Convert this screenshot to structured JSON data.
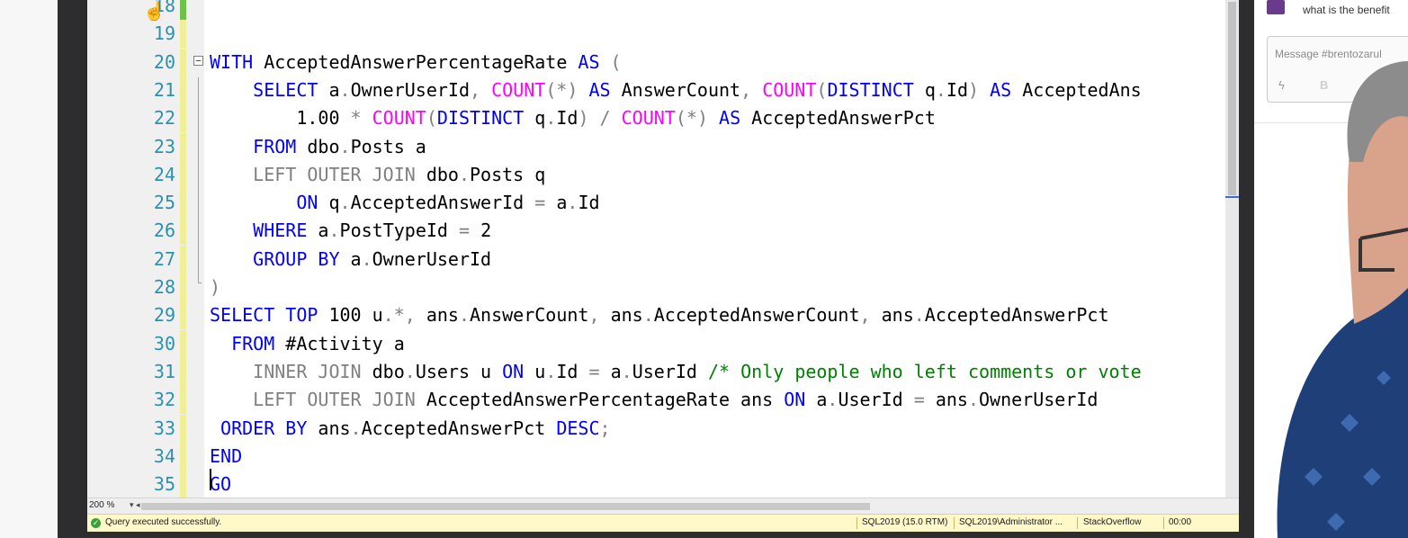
{
  "editor": {
    "lines": [
      {
        "num": "18",
        "change": "saved",
        "tokens": []
      },
      {
        "num": "19",
        "change": "unsaved",
        "tokens": []
      },
      {
        "num": "20",
        "change": "unsaved",
        "tokens": [
          {
            "t": "WITH",
            "c": "kw"
          },
          {
            "t": " AcceptedAnswerPercentageRate ",
            "c": "tx"
          },
          {
            "t": "AS",
            "c": "kw"
          },
          {
            "t": " (",
            "c": "gr"
          }
        ]
      },
      {
        "num": "21",
        "change": "unsaved",
        "tokens": [
          {
            "t": "    ",
            "c": "tx"
          },
          {
            "t": "SELECT",
            "c": "kw"
          },
          {
            "t": " a",
            "c": "tx"
          },
          {
            "t": ".",
            "c": "gr"
          },
          {
            "t": "OwnerUserId",
            "c": "tx"
          },
          {
            "t": ", ",
            "c": "gr"
          },
          {
            "t": "COUNT",
            "c": "fn"
          },
          {
            "t": "(*)",
            "c": "gr"
          },
          {
            "t": " ",
            "c": "tx"
          },
          {
            "t": "AS",
            "c": "kw"
          },
          {
            "t": " AnswerCount",
            "c": "tx"
          },
          {
            "t": ", ",
            "c": "gr"
          },
          {
            "t": "COUNT",
            "c": "fn"
          },
          {
            "t": "(",
            "c": "gr"
          },
          {
            "t": "DISTINCT",
            "c": "kw"
          },
          {
            "t": " q",
            "c": "tx"
          },
          {
            "t": ".",
            "c": "gr"
          },
          {
            "t": "Id",
            "c": "tx"
          },
          {
            "t": ")",
            "c": "gr"
          },
          {
            "t": " ",
            "c": "tx"
          },
          {
            "t": "AS",
            "c": "kw"
          },
          {
            "t": " AcceptedAns",
            "c": "tx"
          }
        ]
      },
      {
        "num": "22",
        "change": "unsaved",
        "tokens": [
          {
            "t": "        1.00 ",
            "c": "tx"
          },
          {
            "t": "*",
            "c": "gr"
          },
          {
            "t": " ",
            "c": "tx"
          },
          {
            "t": "COUNT",
            "c": "fn"
          },
          {
            "t": "(",
            "c": "gr"
          },
          {
            "t": "DISTINCT",
            "c": "kw"
          },
          {
            "t": " q",
            "c": "tx"
          },
          {
            "t": ".",
            "c": "gr"
          },
          {
            "t": "Id",
            "c": "tx"
          },
          {
            "t": ") / ",
            "c": "gr"
          },
          {
            "t": "COUNT",
            "c": "fn"
          },
          {
            "t": "(*)",
            "c": "gr"
          },
          {
            "t": " ",
            "c": "tx"
          },
          {
            "t": "AS",
            "c": "kw"
          },
          {
            "t": " AcceptedAnswerPct",
            "c": "tx"
          }
        ]
      },
      {
        "num": "23",
        "change": "unsaved",
        "tokens": [
          {
            "t": "    ",
            "c": "tx"
          },
          {
            "t": "FROM",
            "c": "kw"
          },
          {
            "t": " dbo",
            "c": "tx"
          },
          {
            "t": ".",
            "c": "gr"
          },
          {
            "t": "Posts a",
            "c": "tx"
          }
        ]
      },
      {
        "num": "24",
        "change": "unsaved",
        "tokens": [
          {
            "t": "    ",
            "c": "tx"
          },
          {
            "t": "LEFT OUTER JOIN",
            "c": "gr"
          },
          {
            "t": " dbo",
            "c": "tx"
          },
          {
            "t": ".",
            "c": "gr"
          },
          {
            "t": "Posts q",
            "c": "tx"
          }
        ]
      },
      {
        "num": "25",
        "change": "unsaved",
        "tokens": [
          {
            "t": "        ",
            "c": "tx"
          },
          {
            "t": "ON",
            "c": "kw"
          },
          {
            "t": " q",
            "c": "tx"
          },
          {
            "t": ".",
            "c": "gr"
          },
          {
            "t": "AcceptedAnswerId ",
            "c": "tx"
          },
          {
            "t": "=",
            "c": "gr"
          },
          {
            "t": " a",
            "c": "tx"
          },
          {
            "t": ".",
            "c": "gr"
          },
          {
            "t": "Id",
            "c": "tx"
          }
        ]
      },
      {
        "num": "26",
        "change": "unsaved",
        "tokens": [
          {
            "t": "    ",
            "c": "tx"
          },
          {
            "t": "WHERE",
            "c": "kw"
          },
          {
            "t": " a",
            "c": "tx"
          },
          {
            "t": ".",
            "c": "gr"
          },
          {
            "t": "PostTypeId ",
            "c": "tx"
          },
          {
            "t": "=",
            "c": "gr"
          },
          {
            "t": " 2",
            "c": "tx"
          }
        ]
      },
      {
        "num": "27",
        "change": "unsaved",
        "tokens": [
          {
            "t": "    ",
            "c": "tx"
          },
          {
            "t": "GROUP BY",
            "c": "kw"
          },
          {
            "t": " a",
            "c": "tx"
          },
          {
            "t": ".",
            "c": "gr"
          },
          {
            "t": "OwnerUserId",
            "c": "tx"
          }
        ]
      },
      {
        "num": "28",
        "change": "unsaved",
        "tokens": [
          {
            "t": ")",
            "c": "gr"
          }
        ]
      },
      {
        "num": "29",
        "change": "unsaved",
        "tokens": [
          {
            "t": "SELECT",
            "c": "kw"
          },
          {
            "t": " ",
            "c": "tx"
          },
          {
            "t": "TOP",
            "c": "kw"
          },
          {
            "t": " 100 u",
            "c": "tx"
          },
          {
            "t": ".*,",
            "c": "gr"
          },
          {
            "t": " ans",
            "c": "tx"
          },
          {
            "t": ".",
            "c": "gr"
          },
          {
            "t": "AnswerCount",
            "c": "tx"
          },
          {
            "t": ", ",
            "c": "gr"
          },
          {
            "t": "ans",
            "c": "tx"
          },
          {
            "t": ".",
            "c": "gr"
          },
          {
            "t": "AcceptedAnswerCount",
            "c": "tx"
          },
          {
            "t": ", ",
            "c": "gr"
          },
          {
            "t": "ans",
            "c": "tx"
          },
          {
            "t": ".",
            "c": "gr"
          },
          {
            "t": "AcceptedAnswerPct",
            "c": "tx"
          }
        ]
      },
      {
        "num": "30",
        "change": "unsaved",
        "tokens": [
          {
            "t": "  ",
            "c": "tx"
          },
          {
            "t": "FROM",
            "c": "kw"
          },
          {
            "t": " #Activity a",
            "c": "tx"
          }
        ]
      },
      {
        "num": "31",
        "change": "unsaved",
        "tokens": [
          {
            "t": "    ",
            "c": "tx"
          },
          {
            "t": "INNER JOIN",
            "c": "gr"
          },
          {
            "t": " dbo",
            "c": "tx"
          },
          {
            "t": ".",
            "c": "gr"
          },
          {
            "t": "Users u ",
            "c": "tx"
          },
          {
            "t": "ON",
            "c": "kw"
          },
          {
            "t": " u",
            "c": "tx"
          },
          {
            "t": ".",
            "c": "gr"
          },
          {
            "t": "Id ",
            "c": "tx"
          },
          {
            "t": "=",
            "c": "gr"
          },
          {
            "t": " a",
            "c": "tx"
          },
          {
            "t": ".",
            "c": "gr"
          },
          {
            "t": "UserId ",
            "c": "tx"
          },
          {
            "t": "/* Only people who left comments or vote",
            "c": "cm"
          }
        ]
      },
      {
        "num": "32",
        "change": "unsaved",
        "tokens": [
          {
            "t": "    ",
            "c": "tx"
          },
          {
            "t": "LEFT OUTER JOIN",
            "c": "gr"
          },
          {
            "t": " AcceptedAnswerPercentageRate ans ",
            "c": "tx"
          },
          {
            "t": "ON",
            "c": "kw"
          },
          {
            "t": " a",
            "c": "tx"
          },
          {
            "t": ".",
            "c": "gr"
          },
          {
            "t": "UserId ",
            "c": "tx"
          },
          {
            "t": "=",
            "c": "gr"
          },
          {
            "t": " ans",
            "c": "tx"
          },
          {
            "t": ".",
            "c": "gr"
          },
          {
            "t": "OwnerUserId",
            "c": "tx"
          }
        ]
      },
      {
        "num": "33",
        "change": "unsaved",
        "tokens": [
          {
            "t": " ",
            "c": "tx"
          },
          {
            "t": "ORDER BY",
            "c": "kw"
          },
          {
            "t": " ans",
            "c": "tx"
          },
          {
            "t": ".",
            "c": "gr"
          },
          {
            "t": "AcceptedAnswerPct ",
            "c": "tx"
          },
          {
            "t": "DESC",
            "c": "kw"
          },
          {
            "t": ";",
            "c": "gr"
          }
        ]
      },
      {
        "num": "34",
        "change": "unsaved",
        "tokens": [
          {
            "t": "END",
            "c": "kw"
          }
        ]
      },
      {
        "num": "35",
        "change": "unsaved",
        "tokens": [
          {
            "t": "GO",
            "c": "kw"
          }
        ]
      }
    ]
  },
  "zoom": {
    "value": "200 %"
  },
  "statusbar": {
    "message": "Query executed successfully.",
    "server": "SQL2019 (15.0 RTM)",
    "user": "SQL2019\\Administrator ...",
    "database": "StackOverflow",
    "time": "00:00"
  },
  "chat": {
    "snippet": "what is the benefit",
    "placeholder": "Message #brentozarul",
    "bold_label": "B"
  },
  "colors": {
    "keyword": "#0000ff",
    "function": "#ff00ff",
    "operator": "#808080",
    "comment": "#008000",
    "line_number": "#2b91af",
    "statusbar_bg": "#fff8c8"
  },
  "icons": [
    "collapse-icon",
    "success-icon",
    "lightning-icon",
    "hand-cursor-icon"
  ]
}
